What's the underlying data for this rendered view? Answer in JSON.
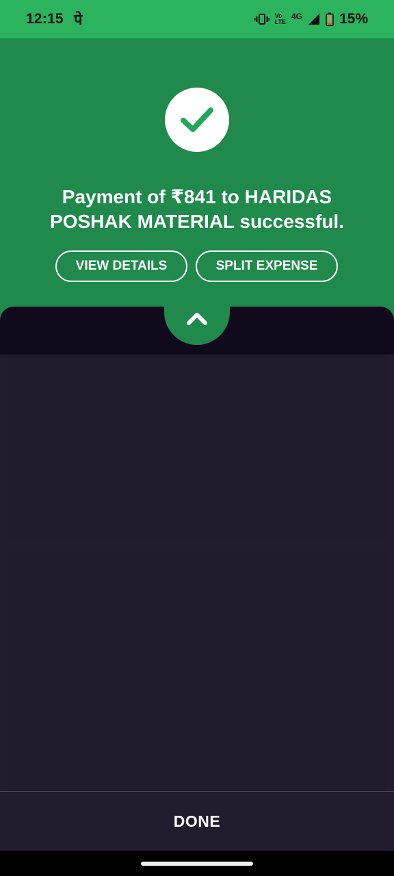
{
  "status_bar": {
    "time": "12:15",
    "notification_glyph": "पे",
    "volte_top": "Vo",
    "volte_bottom": "LTE",
    "network": "4G",
    "battery_percent": "15%",
    "icons": [
      "vibrate-icon",
      "volte-icon",
      "signal-icon",
      "battery-icon"
    ]
  },
  "header": {
    "icon": "checkmark-icon",
    "message": "Payment of ₹841 to HARIDAS POSHAK MATERIAL successful.",
    "buttons": {
      "view_details": "VIEW DETAILS",
      "split_expense": "SPLIT EXPENSE"
    }
  },
  "sheet": {
    "handle_icon": "chevron-up-icon"
  },
  "footer": {
    "done_label": "DONE"
  },
  "colors": {
    "status_bar_green": "#2bb35d",
    "header_green": "#1f8a4b",
    "sheet_dark": "#100a1c",
    "content_bg": "#231c2e"
  }
}
